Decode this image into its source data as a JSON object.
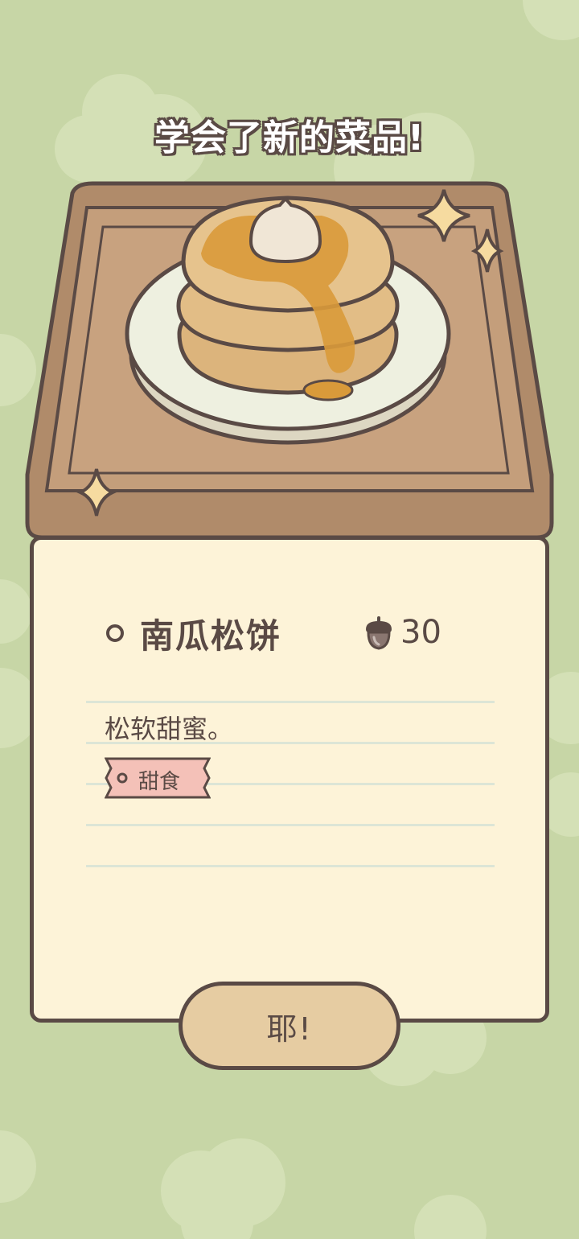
{
  "header": {
    "title": "学会了新的菜品!"
  },
  "illustration": {
    "icon": "pancake-stack-on-tray",
    "decorations": [
      "sparkle-icon",
      "sparkle-icon",
      "sparkle-icon"
    ]
  },
  "card": {
    "dish_name": "南瓜松饼",
    "price": "30",
    "price_icon": "acorn-icon",
    "description": "松软甜蜜。",
    "tag": "甜食"
  },
  "actions": {
    "confirm_label": "耶!"
  },
  "colors": {
    "background": "#c7d6a6",
    "outline": "#5a4a45",
    "card": "#fdf3d8",
    "tray": "#b08b6a",
    "button": "#e6cca2",
    "tag": "#f4c1b8"
  }
}
